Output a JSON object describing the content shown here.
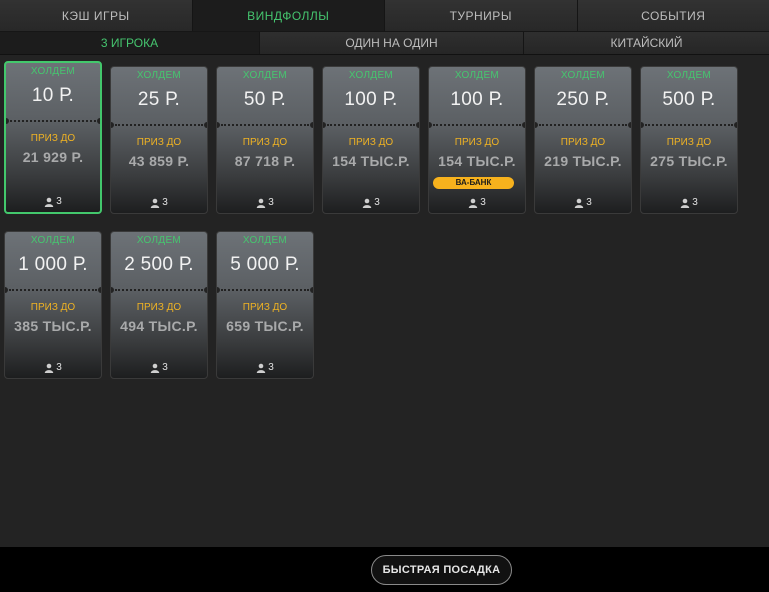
{
  "top_tabs": [
    {
      "label": "КЭШ ИГРЫ",
      "active": false
    },
    {
      "label": "ВИНДФОЛЛЫ",
      "active": true
    },
    {
      "label": "ТУРНИРЫ",
      "active": false
    },
    {
      "label": "СОБЫТИЯ",
      "active": false
    }
  ],
  "sub_tabs": [
    {
      "label": "3 ИГРОКА",
      "active": true
    },
    {
      "label": "ОДИН НА ОДИН",
      "active": false
    },
    {
      "label": "КИТАЙСКИЙ",
      "active": false
    }
  ],
  "colors": {
    "accent_green": "#43c86c",
    "prize_gold": "#f0b323",
    "badge_yellow": "#f7b21d"
  },
  "cards": [
    {
      "game": "ХОЛДЕМ",
      "stake": "10 Р.",
      "prize_label": "ПРИЗ ДО",
      "prize": "21 929 Р.",
      "players": "3",
      "selected": true
    },
    {
      "game": "ХОЛДЕМ",
      "stake": "25 Р.",
      "prize_label": "ПРИЗ ДО",
      "prize": "43 859 Р.",
      "players": "3"
    },
    {
      "game": "ХОЛДЕМ",
      "stake": "50 Р.",
      "prize_label": "ПРИЗ ДО",
      "prize": "87 718 Р.",
      "players": "3"
    },
    {
      "game": "ХОЛДЕМ",
      "stake": "100 Р.",
      "prize_label": "ПРИЗ ДО",
      "prize": "154 ТЫС.Р.",
      "players": "3"
    },
    {
      "game": "ХОЛДЕМ",
      "stake": "100 Р.",
      "prize_label": "ПРИЗ ДО",
      "prize": "154 ТЫС.Р.",
      "players": "3",
      "badge": "ВА-БАНК"
    },
    {
      "game": "ХОЛДЕМ",
      "stake": "250 Р.",
      "prize_label": "ПРИЗ ДО",
      "prize": "219 ТЫС.Р.",
      "players": "3"
    },
    {
      "game": "ХОЛДЕМ",
      "stake": "500 Р.",
      "prize_label": "ПРИЗ ДО",
      "prize": "275 ТЫС.Р.",
      "players": "3"
    },
    {
      "game": "ХОЛДЕМ",
      "stake": "1 000 Р.",
      "prize_label": "ПРИЗ ДО",
      "prize": "385 ТЫС.Р.",
      "players": "3"
    },
    {
      "game": "ХОЛДЕМ",
      "stake": "2 500 Р.",
      "prize_label": "ПРИЗ ДО",
      "prize": "494 ТЫС.Р.",
      "players": "3"
    },
    {
      "game": "ХОЛДЕМ",
      "stake": "5 000 Р.",
      "prize_label": "ПРИЗ ДО",
      "prize": "659 ТЫС.Р.",
      "players": "3"
    }
  ],
  "player_icon": "person-icon",
  "bottom": {
    "quick_seat_label": "БЫСТРАЯ ПОСАДКА"
  }
}
